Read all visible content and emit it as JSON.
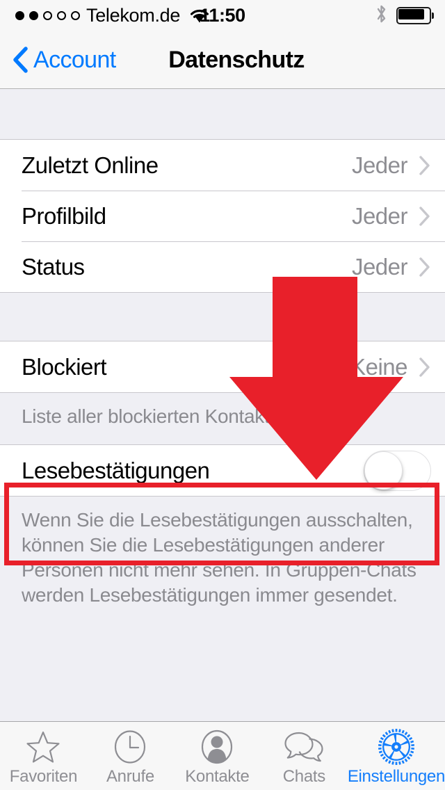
{
  "status_bar": {
    "carrier": "Telekom.de",
    "signal_dots_total": 5,
    "signal_dots_filled": 2,
    "wifi_icon": "wifi-icon",
    "time": "11:50",
    "bluetooth_icon": "bluetooth-icon",
    "battery_icon": "battery-icon",
    "battery_level_percent": 78
  },
  "nav_bar": {
    "back_label": "Account",
    "back_icon": "chevron-left-icon",
    "title": "Datenschutz",
    "accent_color": "#007AFF"
  },
  "sections": [
    {
      "rows": [
        {
          "label": "Zuletzt Online",
          "value": "Jeder",
          "accessory": "chevron-right-icon"
        },
        {
          "label": "Profilbild",
          "value": "Jeder",
          "accessory": "chevron-right-icon"
        },
        {
          "label": "Status",
          "value": "Jeder",
          "accessory": "chevron-right-icon"
        }
      ],
      "footer": ""
    },
    {
      "rows": [
        {
          "label": "Blockiert",
          "value": "Keine",
          "accessory": "chevron-right-icon"
        }
      ],
      "footer": "Liste aller blockierten Kontakte."
    },
    {
      "rows": [
        {
          "label": "Lesebestätigungen",
          "value": "",
          "accessory": "toggle-switch",
          "toggle_on": false
        }
      ],
      "footer": "Wenn Sie die Lesebestätigungen ausschalten, können Sie die Lesebestätigungen anderer Personen nicht mehr sehen. In Gruppen-Chats werden Lesebestätigungen immer gesendet."
    }
  ],
  "annotations": {
    "arrow_color": "#E8202A",
    "highlight_color": "#E8202A",
    "arrow_points_to": "Lesebestätigungen"
  },
  "tab_bar": {
    "items": [
      {
        "label": "Favoriten",
        "icon": "star-icon",
        "active": false
      },
      {
        "label": "Anrufe",
        "icon": "clock-icon",
        "active": false
      },
      {
        "label": "Kontakte",
        "icon": "person-icon",
        "active": false
      },
      {
        "label": "Chats",
        "icon": "chat-bubbles-icon",
        "active": false
      },
      {
        "label": "Einstellungen",
        "icon": "gear-icon",
        "active": true
      }
    ],
    "active_color": "#147EFB",
    "inactive_color": "#8E8E93"
  }
}
